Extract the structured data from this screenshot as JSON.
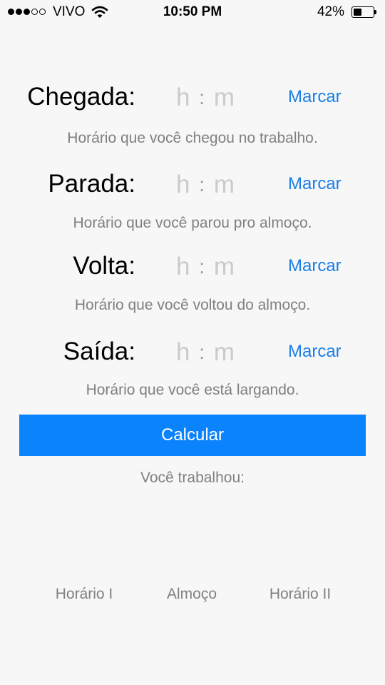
{
  "status_bar": {
    "signal_bars_filled": 3,
    "signal_bars_total": 5,
    "carrier": "VIVO",
    "time": "10:50 PM",
    "battery_percent": "42%",
    "battery_level": 0.42
  },
  "rows": [
    {
      "label": "Chegada:",
      "hour_placeholder": "h",
      "separator": ":",
      "minute_placeholder": "m",
      "button": "Marcar",
      "hint": "Horário que você chegou no trabalho."
    },
    {
      "label": "Parada:",
      "hour_placeholder": "h",
      "separator": ":",
      "minute_placeholder": "m",
      "button": "Marcar",
      "hint": "Horário que você parou pro almoço."
    },
    {
      "label": "Volta:",
      "hour_placeholder": "h",
      "separator": ":",
      "minute_placeholder": "m",
      "button": "Marcar",
      "hint": "Horário que você voltou do almoço."
    },
    {
      "label": "Saída:",
      "hour_placeholder": "h",
      "separator": ":",
      "minute_placeholder": "m",
      "button": "Marcar",
      "hint": "Horário que você está largando."
    }
  ],
  "calculate_button": "Calcular",
  "result_label": "Você trabalhou:",
  "summary": {
    "horario_1": "Horário I",
    "almoco": "Almoço",
    "horario_2": "Horário II"
  },
  "colors": {
    "accent": "#1a7fe6",
    "button_bg": "#0b83fd",
    "hint_text": "#808080",
    "background": "#f7f7f7"
  },
  "icons": [
    "wifi-icon",
    "battery-icon"
  ]
}
